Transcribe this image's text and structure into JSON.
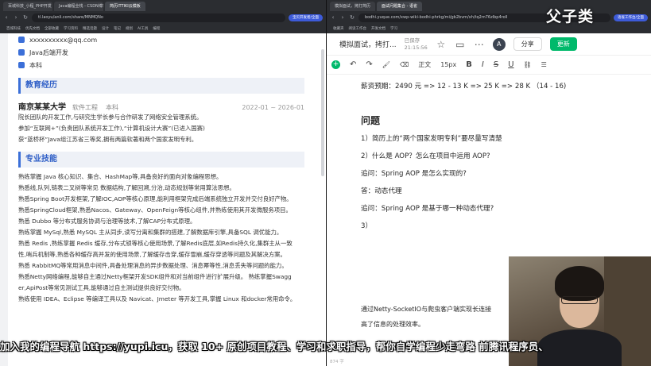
{
  "brand": "父子类",
  "left_browser": {
    "tabs": [
      "百城科技_小程_PHP开发",
      "Java编程全栈 - CSDN博客",
      "简历ITTIKI云模板"
    ],
    "address": "tl.laoyu/anli.com/share/MNMQNo",
    "chip": "宝贝开发者/全面",
    "bookmarks": [
      "百城科技",
      "优先文档",
      "全部收藏",
      "学习资料",
      "精选话题",
      "设计",
      "笔记",
      "规划",
      "AI工具",
      "编程"
    ]
  },
  "right_browser": {
    "tabs": [
      "模拟面试，拷打简历",
      "面试问题集合 - 语雀"
    ],
    "address": "bodhi.yuque.com/xwp-wiki-bodhi-phrkg/mi/gb2bvm/xh/tq2m76zlbp4roll",
    "chip": "语雀工作台/全面",
    "bookmarks": [
      "收藏夹",
      "阅读工作台",
      "开发文档",
      "学习"
    ]
  },
  "resume": {
    "contacts": [
      {
        "icon": "mail-icon",
        "text": "xxxxxxxxxx@qq.com"
      },
      {
        "icon": "briefcase-icon",
        "text": "Java后端开发"
      },
      {
        "icon": "graduation-icon",
        "text": "本科"
      }
    ],
    "education": {
      "title": "教育经历",
      "school": "南京某某大学",
      "major": "软件工程",
      "degree": "本科",
      "dates": "2022-01 ~ 2026-01",
      "lines": [
        "院长团队的开发工作,与研究生学长参与合作研发了网络安全管理系统。",
        "参加“互联网+”(负责团队系统开发工作),“计算机设计大赛”(已进入国赛)",
        "获“蓝桥杯”Java组江苏省三等奖,拥有两篇软著和两个国家发明专利。"
      ]
    },
    "skills": {
      "title": "专业技能",
      "lines": [
        "熟练掌握 Java 核心知识、集合、HashMap等,具备良好的面向对象编程思想。",
        "熟悉线,队列,链表二叉树等常见 数据结构,了解回溯,分治,动态规划等常用算法思想。",
        "熟悉Spring Boot开发框架,了解IOC,AOP等核心原理,能利用框架完成后端系统独立开发并交付良好产物。",
        "熟悉SpringCloud框架,熟悉Nacos、Gateway、OpenFeign等核心组件,并熟练使用其开发微服务项目。",
        "熟悉 Dubbo 等分布式服务协调与治理等技术,了解CAP分布式原理。",
        "熟练掌握 MySql,熟悉 MySQL 主从同步,读写分离和集群的搭建,了解数据库引擎,具备SQL 调优能力。",
        "熟悉 Redis ,熟练掌握 Redis 缓存,分布式锁等核心使用场景,了解Redis底层,如Redis持久化,集群主从一致",
        "性,哨兵机制等,熟悉各种缓存高并发的使用场景,了解缓存击穿,缓存雪崩,缓存穿透等问题及其解决方案。",
        "熟悉 RabbitMQ等常用消息中间件,具备处理消息的异步数据处理、消息幂等性,消息丢失等问题的能力。",
        "熟悉Netty网络编程,能够自主通过Netty框架开发SDK组件和对当前组件进行扩展升级。 熟练掌握Swagg",
        "er,ApiPost等常见测试工具,能够通过自主测试提供良好交付物。",
        "熟练使用 IDEA、Eclipse 等编译工具以及 Navicat、Jmeter 等开发工具,掌握 Linux 和docker常用命令。"
      ]
    }
  },
  "doc": {
    "title": "模拟面试，拷打...",
    "saved": "已保存",
    "time": "21:15:56",
    "avatar_letter": "A",
    "share_label": "分享",
    "update_label": "更新",
    "toolbar": {
      "undo": "↶",
      "redo": "↷",
      "brush": "🖌",
      "clear": "⌫",
      "style": "正文",
      "size": "15px",
      "bold": "B",
      "italic": "I",
      "strike": "S",
      "underline": "U",
      "link": "⛓",
      "more": "☰"
    },
    "salary_line": "薪资预期：2490 元 => 12 - 13 K => 25 K => 28 K （14 - 16)",
    "heading": "问题",
    "questions": [
      "1）简历上的“两个国家发明专利”要尽量写清楚",
      "2）什么是 AOP？怎么在项目中运用 AOP?",
      "追问：Spring AOP 是怎么实现的?",
      "答：动态代理",
      "追问：Spring AOP 是基于哪一种动态代理?",
      "3）"
    ],
    "tail_lines": [
      "通过Netty-SocketIO与爬虫客户端实现长连接",
      "高了信息的处理效率。"
    ],
    "word_count": "874 字"
  },
  "subtitle": "加入我的编程导航 https://yupi.icu，获取 10+ 原创项目教程、学习和求职指导，帮你自学编程少走弯路 前腾讯程序员、"
}
